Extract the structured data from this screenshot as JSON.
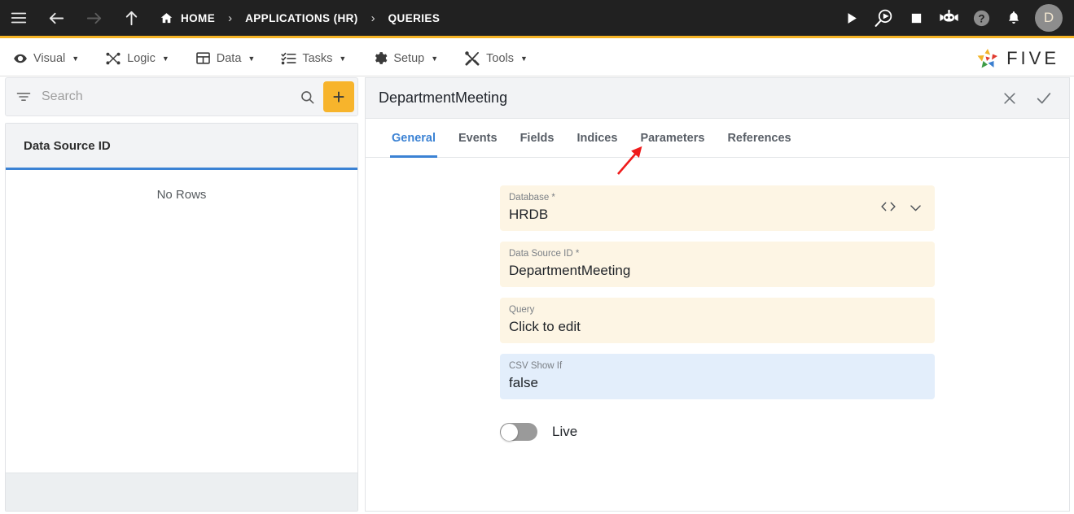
{
  "topbar": {
    "nav_icons": [
      {
        "name": "hamburger-menu-icon",
        "enabled": true
      },
      {
        "name": "back-arrow-icon",
        "enabled": true
      },
      {
        "name": "forward-arrow-icon",
        "enabled": false
      },
      {
        "name": "up-arrow-icon",
        "enabled": true
      }
    ],
    "breadcrumb": [
      {
        "label": "HOME",
        "icon": "home-icon"
      },
      {
        "label": "APPLICATIONS (HR)",
        "icon": ""
      },
      {
        "label": "QUERIES",
        "icon": ""
      }
    ],
    "separator": "›",
    "actions": [
      {
        "name": "run-icon",
        "title": "Run"
      },
      {
        "name": "debug-icon",
        "title": "Debug"
      },
      {
        "name": "stop-icon",
        "title": "Stop"
      },
      {
        "name": "chatbot-icon",
        "title": "Assistant"
      },
      {
        "name": "help-icon",
        "title": "Help"
      },
      {
        "name": "notifications-bell-icon",
        "title": "Notifications"
      }
    ],
    "avatar_initial": "D",
    "background": "#212121",
    "accent_underline": "#f5b325"
  },
  "menubar": {
    "items": [
      {
        "label": "Visual",
        "icon": "eye-icon"
      },
      {
        "label": "Logic",
        "icon": "logic-nodes-icon"
      },
      {
        "label": "Data",
        "icon": "table-grid-icon"
      },
      {
        "label": "Tasks",
        "icon": "checklist-icon"
      },
      {
        "label": "Setup",
        "icon": "gear-icon"
      },
      {
        "label": "Tools",
        "icon": "tools-cross-icon"
      }
    ],
    "caret": "▼",
    "brand": {
      "text": "FIVE",
      "logo": "five-star-logo"
    }
  },
  "sidebar": {
    "search": {
      "value": "",
      "placeholder": "Search"
    },
    "filter_icon": "filter-icon",
    "search_icon": "search-icon",
    "add_button_label": "+",
    "list": {
      "column_header": "Data Source ID",
      "rows": [],
      "empty_message": "No Rows"
    },
    "accent": "#3b82d4"
  },
  "detail": {
    "title": "DepartmentMeeting",
    "header_actions": [
      {
        "name": "close-icon",
        "label": "✕"
      },
      {
        "name": "confirm-check-icon",
        "label": "✓"
      }
    ],
    "tabs": [
      {
        "label": "General",
        "active": true
      },
      {
        "label": "Events",
        "active": false
      },
      {
        "label": "Fields",
        "active": false
      },
      {
        "label": "Indices",
        "active": false
      },
      {
        "label": "Parameters",
        "active": false
      },
      {
        "label": "References",
        "active": false
      }
    ],
    "fields": [
      {
        "label": "Database *",
        "value": "HRDB",
        "style": "cream",
        "icons": [
          "code-brackets-icon",
          "chevron-down-icon"
        ]
      },
      {
        "label": "Data Source ID *",
        "value": "DepartmentMeeting",
        "style": "cream",
        "icons": []
      },
      {
        "label": "Query",
        "value": "Click to edit",
        "style": "cream",
        "icons": []
      },
      {
        "label": "CSV Show If",
        "value": "false",
        "style": "blue",
        "icons": []
      }
    ],
    "toggle": {
      "label": "Live",
      "checked": false
    }
  },
  "annotation": {
    "type": "arrow",
    "color": "#ef1b1b",
    "points_to": "Parameters"
  }
}
